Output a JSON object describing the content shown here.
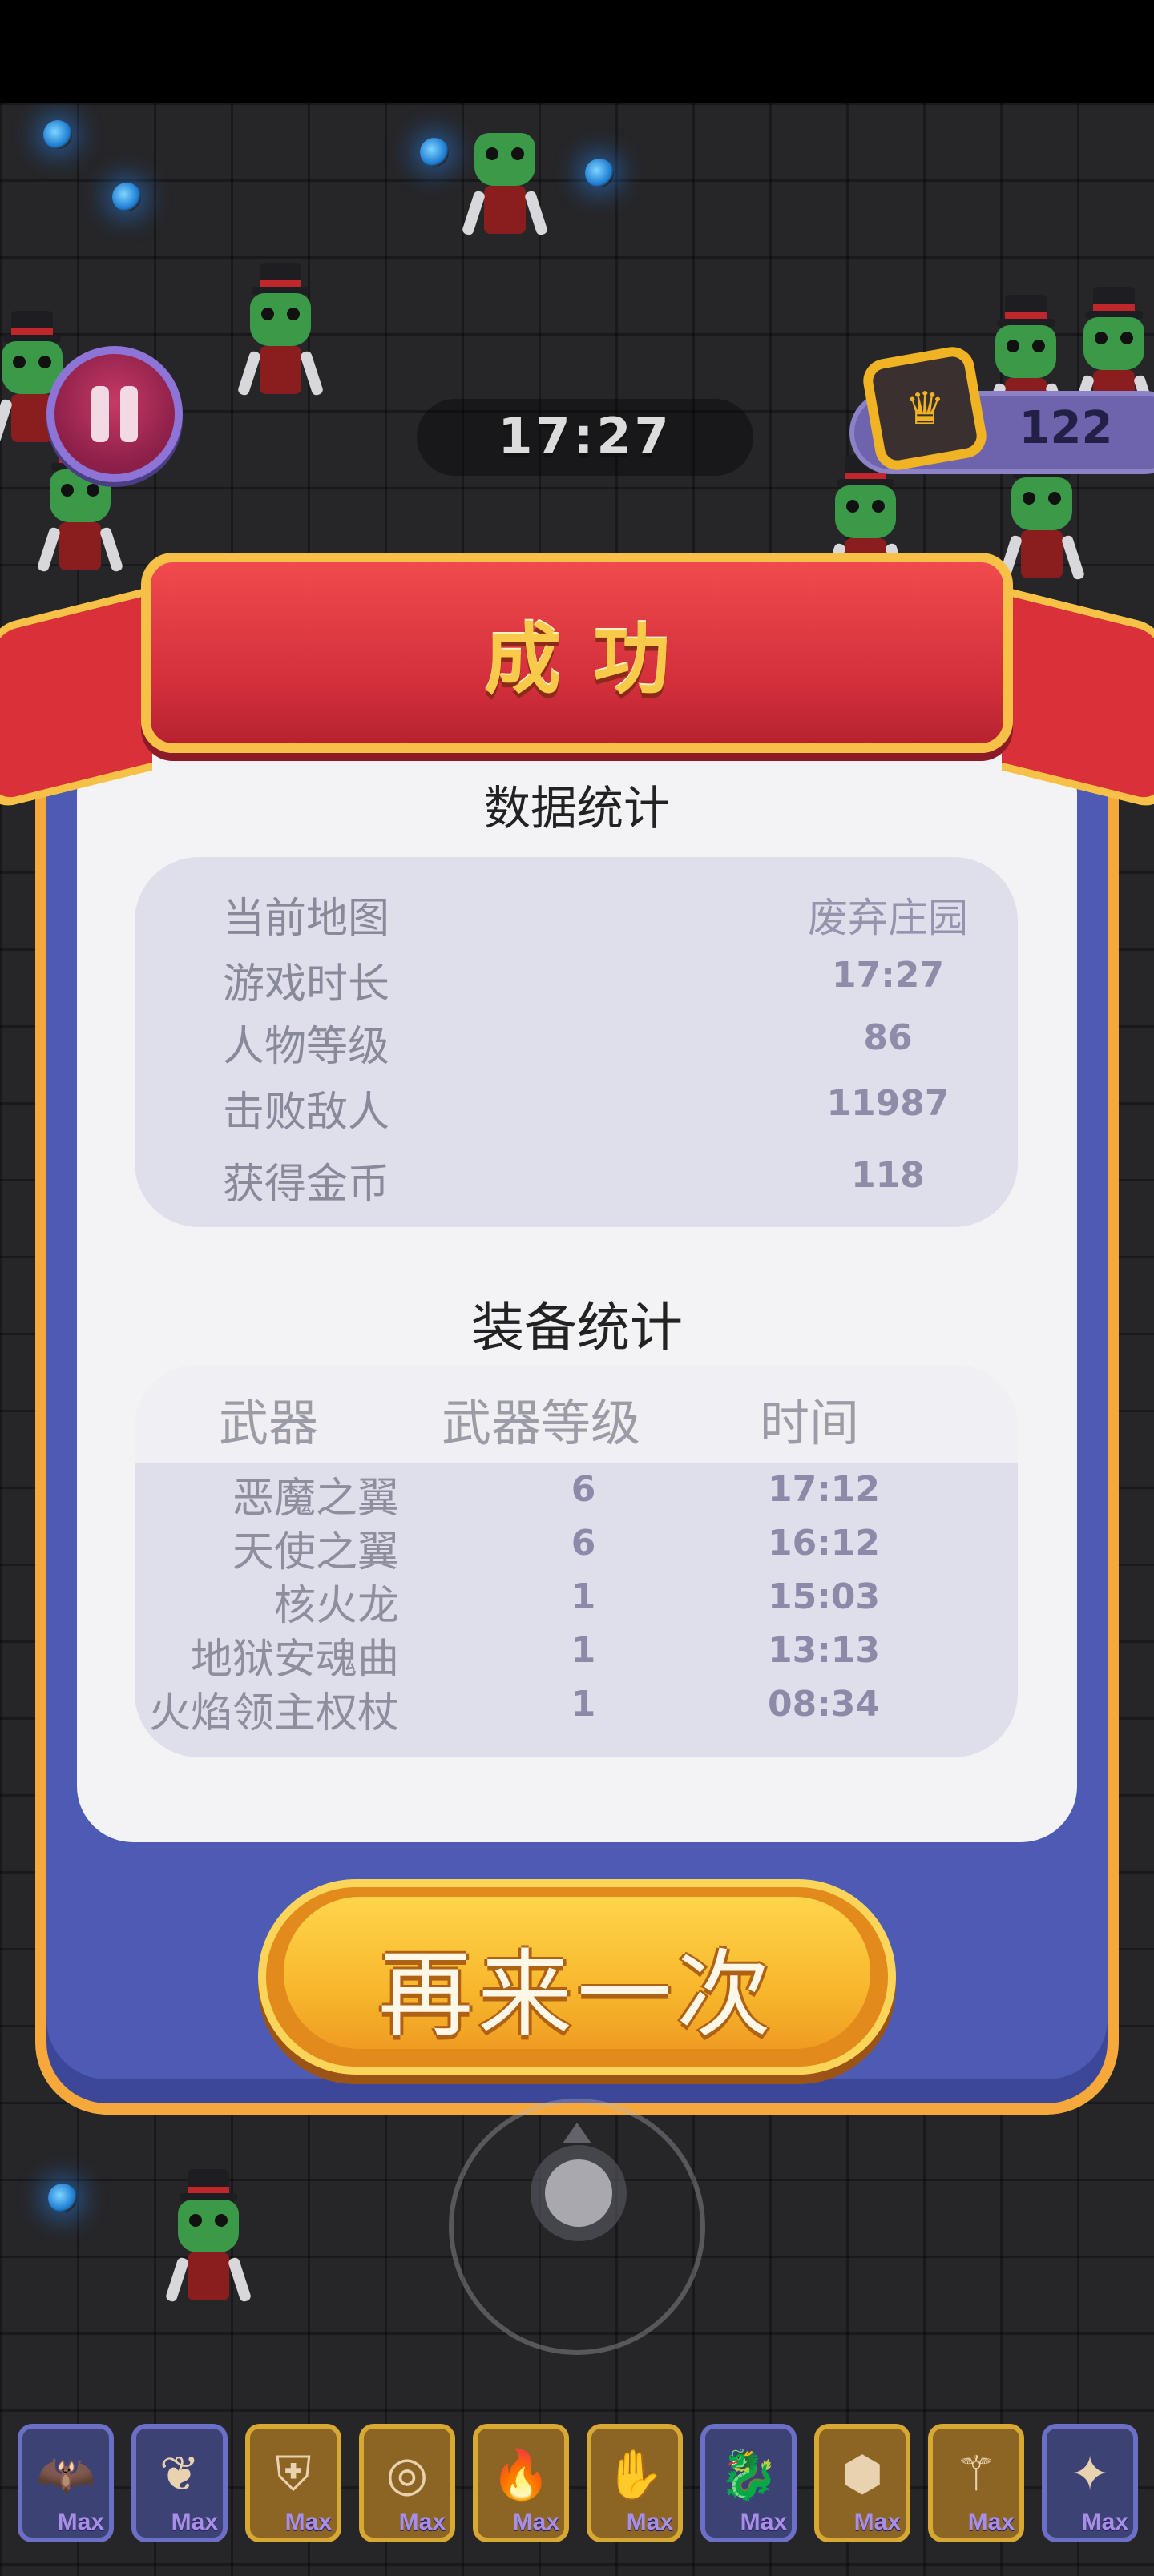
{
  "hud": {
    "timer": "17:27",
    "coins": "122",
    "pause_icon": "pause-icon",
    "coin_icon": "crown-coin-icon"
  },
  "dialog": {
    "title": "成功",
    "stats_title": "数据统计",
    "stats": [
      {
        "label": "当前地图",
        "value": "废弃庄园"
      },
      {
        "label": "游戏时长",
        "value": "17:27"
      },
      {
        "label": "人物等级",
        "value": "86"
      },
      {
        "label": "击败敌人",
        "value": "11987"
      },
      {
        "label": "获得金币",
        "value": "118"
      }
    ],
    "equipment_title": "装备统计",
    "equipment_headers": {
      "weapon": "武器",
      "level": "武器等级",
      "time": "时间"
    },
    "equipment": [
      {
        "name": "恶魔之翼",
        "level": "6",
        "time": "17:12"
      },
      {
        "name": "天使之翼",
        "level": "6",
        "time": "16:12"
      },
      {
        "name": "核火龙",
        "level": "1",
        "time": "15:03"
      },
      {
        "name": "地狱安魂曲",
        "level": "1",
        "time": "13:13"
      },
      {
        "name": "火焰领主权杖",
        "level": "1",
        "time": "08:34"
      }
    ],
    "retry_label": "再来一次"
  },
  "weapon_bar": [
    {
      "icon": "demon-wings-icon",
      "badge": "Max",
      "frame": "blue"
    },
    {
      "icon": "angel-wings-icon",
      "badge": "Max",
      "frame": "blue"
    },
    {
      "icon": "armor-icon",
      "badge": "Max",
      "frame": "gold"
    },
    {
      "icon": "ring-icon",
      "badge": "Max",
      "frame": "gold"
    },
    {
      "icon": "torch-icon",
      "badge": "Max",
      "frame": "gold"
    },
    {
      "icon": "glove-icon",
      "badge": "Max",
      "frame": "gold"
    },
    {
      "icon": "dragon-icon",
      "badge": "Max",
      "frame": "blue"
    },
    {
      "icon": "shield-icon",
      "badge": "Max",
      "frame": "gold"
    },
    {
      "icon": "staff-icon",
      "badge": "Max",
      "frame": "gold"
    },
    {
      "icon": "crystal-icon",
      "badge": "Max",
      "frame": "blue"
    }
  ],
  "colors": {
    "ribbon": "#d9303a",
    "ribbon_trim": "#f7c148",
    "modal": "#4e5bb4",
    "modal_border": "#f6a93a",
    "retry_button": "#f7b52b"
  }
}
